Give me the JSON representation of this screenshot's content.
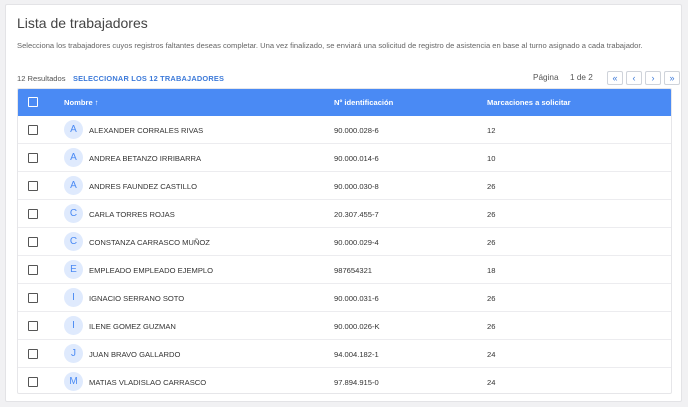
{
  "page": {
    "title": "Lista de trabajadores",
    "description": "Selecciona los trabajadores cuyos registros faltantes deseas completar. Una vez finalizado, se enviará una solicitud de registro de asistencia en base al turno asignado a cada trabajador."
  },
  "toolbar": {
    "results": "12 Resultados",
    "select_all": "SELECCIONAR LOS 12 TRABAJADORES"
  },
  "pagination": {
    "label": "Página",
    "count": "1 de 2",
    "first": "«",
    "prev": "‹",
    "next": "›",
    "last": "»"
  },
  "table": {
    "columns": {
      "name": "Nombre ↑",
      "id": "Nº identificación",
      "marks": "Marcaciones a solicitar"
    },
    "rows": [
      {
        "initial": "A",
        "name": "ALEXANDER CORRALES RIVAS",
        "id": "90.000.028-6",
        "marks": "12"
      },
      {
        "initial": "A",
        "name": "ANDREA BETANZO IRRIBARRA",
        "id": "90.000.014-6",
        "marks": "10"
      },
      {
        "initial": "A",
        "name": "ANDRES FAUNDEZ CASTILLO",
        "id": "90.000.030-8",
        "marks": "26"
      },
      {
        "initial": "C",
        "name": "CARLA TORRES ROJAS",
        "id": "20.307.455-7",
        "marks": "26"
      },
      {
        "initial": "C",
        "name": "CONSTANZA CARRASCO MUÑOZ",
        "id": "90.000.029-4",
        "marks": "26"
      },
      {
        "initial": "E",
        "name": "EMPLEADO EMPLEADO EJEMPLO",
        "id": "987654321",
        "marks": "18"
      },
      {
        "initial": "I",
        "name": "IGNACIO SERRANO SOTO",
        "id": "90.000.031-6",
        "marks": "26"
      },
      {
        "initial": "I",
        "name": "ILENE GOMEZ GUZMAN",
        "id": "90.000.026-K",
        "marks": "26"
      },
      {
        "initial": "J",
        "name": "JUAN BRAVO GALLARDO",
        "id": "94.004.182-1",
        "marks": "24"
      },
      {
        "initial": "M",
        "name": "MATIAS VLADISLAO CARRASCO",
        "id": "97.894.915-0",
        "marks": "24"
      }
    ]
  },
  "colors": {
    "header_bg": "#4a8af4",
    "accent": "#3d7ad9",
    "avatar_bg": "#dfeafd"
  }
}
